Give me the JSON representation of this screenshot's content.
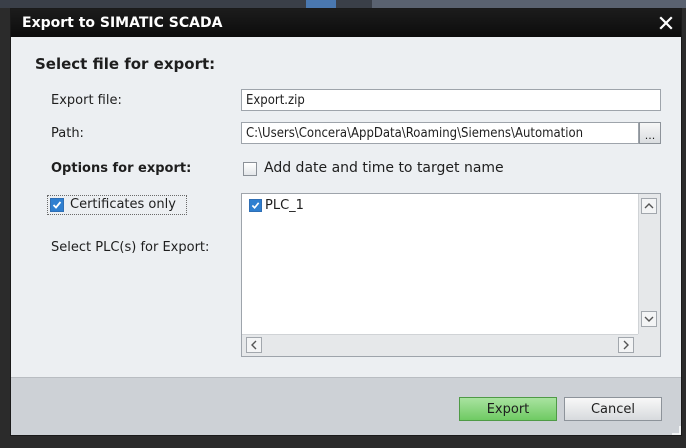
{
  "dialog": {
    "title": "Export to SIMATIC SCADA",
    "close_glyph": "✕"
  },
  "form": {
    "section_title": "Select file for export:",
    "export_file_label": "Export file:",
    "export_file_value": "Export.zip",
    "path_label": "Path:",
    "path_value": "C:\\Users\\Concera\\AppData\\Roaming\\Siemens\\Automation",
    "browse_label": "...",
    "options_label": "Options for export:",
    "add_date_label": "Add date and time to target name",
    "add_date_checked": false,
    "certificates_label": "Certificates only",
    "certificates_checked": true,
    "select_plc_label": "Select PLC(s) for Export:"
  },
  "plc_list": {
    "items": [
      {
        "label": "PLC_1",
        "checked": true
      }
    ]
  },
  "buttons": {
    "export_label": "Export",
    "cancel_label": "Cancel"
  },
  "colors": {
    "titlebar": "#111111",
    "dialog_bg": "#eceff2",
    "footer_bg": "#cdd1d6",
    "export_button": "#8fd884",
    "checkbox_accent": "#2f7fd0"
  },
  "icons": {
    "close": "close-icon",
    "checkmark": "checkmark-icon",
    "scroll_up": "chevron-up-icon",
    "scroll_down": "chevron-down-icon",
    "scroll_left": "chevron-left-icon",
    "scroll_right": "chevron-right-icon"
  }
}
